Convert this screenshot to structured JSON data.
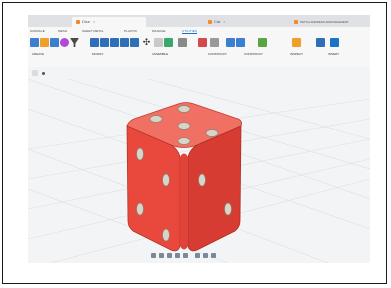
{
  "browser": {
    "tabs": [
      {
        "label": "Dice",
        "active": true
      },
      {
        "label": "Cat",
        "active": false
      },
      {
        "label": "PETKA ADDRESS ARRANGEMENT",
        "active": false
      }
    ]
  },
  "ribbon": {
    "tabs": [
      "SURFACE",
      "MESH",
      "SHEET METAL",
      "PLASTIC",
      "MANAGE",
      "UTILITIES"
    ],
    "groups": [
      "CREATE",
      "MODIFY",
      "ASSEMBLE",
      "CONSTRUCT",
      "CONSTRUCT",
      "INSPECT",
      "INSERT"
    ]
  },
  "model": {
    "object": "dice",
    "body_color": "#e9483d",
    "pip_color": "#d9d4c8"
  },
  "colors": {
    "accent": "#1a73c8",
    "toolbar_bg": "#f7f7f7",
    "viewport_bg": "#f3f4f6"
  },
  "icons": [
    "sketch-icon",
    "box-icon",
    "extrude-icon",
    "fillet-icon",
    "move-icon",
    "joint-icon",
    "plane-icon",
    "measure-icon",
    "insert-icon",
    "orbit-icon",
    "pan-icon",
    "zoom-icon",
    "display-icon",
    "grid-icon"
  ]
}
